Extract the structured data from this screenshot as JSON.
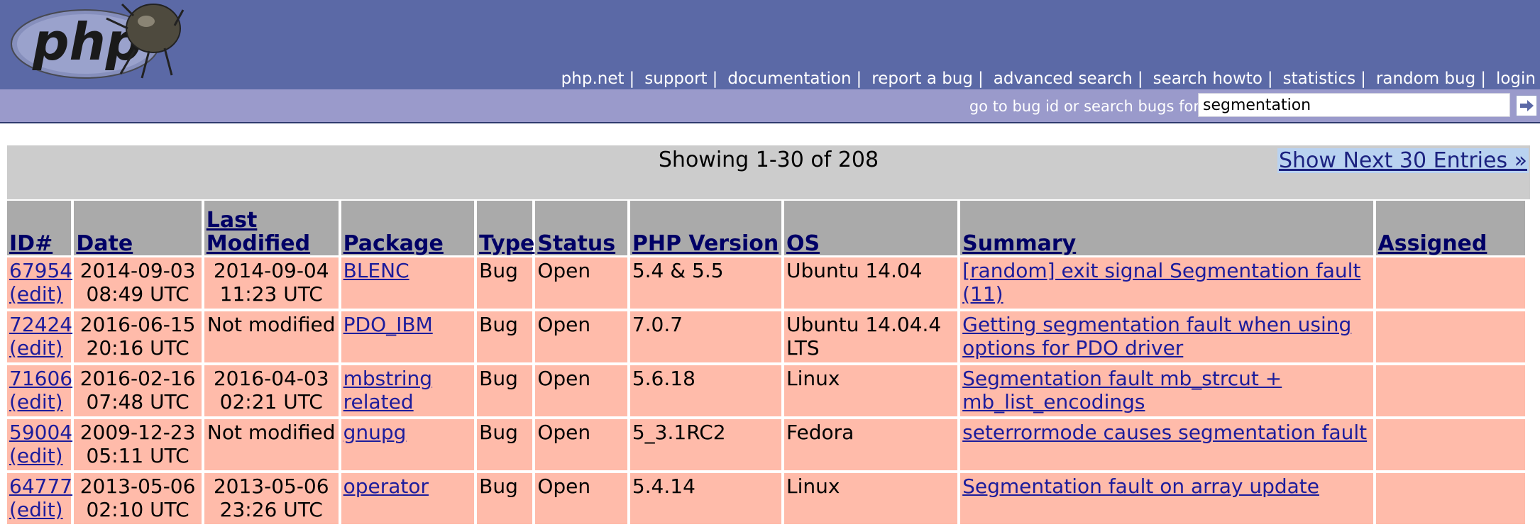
{
  "header": {
    "logo_text": "php",
    "nav": [
      "php.net",
      "support",
      "documentation",
      "report a bug",
      "advanced search",
      "search howto",
      "statistics",
      "random bug",
      "login"
    ]
  },
  "search": {
    "label": "go to bug id or search bugs for",
    "value": "segmentation"
  },
  "results": {
    "showing": "Showing 1-30 of 208",
    "next_link": "Show Next 30 Entries »"
  },
  "table": {
    "columns": [
      "ID#",
      "Date",
      "Last Modified",
      "Package",
      "Type",
      "Status",
      "PHP Version",
      "OS",
      "Summary",
      "Assigned"
    ],
    "rows": [
      {
        "id": "67954",
        "edit": "(edit)",
        "date": "2014-09-03",
        "date_time": "08:49 UTC",
        "modified": "2014-09-04",
        "modified_time": "11:23 UTC",
        "package": "BLENC",
        "type": "Bug",
        "status": "Open",
        "php_version": "5.4 & 5.5",
        "os": "Ubuntu 14.04",
        "summary": "[random] exit signal Segmentation fault (11)",
        "assigned": ""
      },
      {
        "id": "72424",
        "edit": "(edit)",
        "date": "2016-06-15",
        "date_time": "20:16 UTC",
        "modified": "Not modified",
        "modified_time": "",
        "package": "PDO_IBM",
        "type": "Bug",
        "status": "Open",
        "php_version": "7.0.7",
        "os": "Ubuntu 14.04.4 LTS",
        "summary": "Getting segmentation fault when using options for PDO driver",
        "assigned": ""
      },
      {
        "id": "71606",
        "edit": "(edit)",
        "date": "2016-02-16",
        "date_time": "07:48 UTC",
        "modified": "2016-04-03",
        "modified_time": "02:21 UTC",
        "package": "mbstring related",
        "type": "Bug",
        "status": "Open",
        "php_version": "5.6.18",
        "os": "Linux",
        "summary": "Segmentation fault mb_strcut + mb_list_encodings",
        "assigned": ""
      },
      {
        "id": "59004",
        "edit": "(edit)",
        "date": "2009-12-23",
        "date_time": "05:11 UTC",
        "modified": "Not modified",
        "modified_time": "",
        "package": "gnupg",
        "type": "Bug",
        "status": "Open",
        "php_version": "5_3.1RC2",
        "os": "Fedora",
        "summary": "seterrormode causes segmentation fault",
        "assigned": ""
      },
      {
        "id": "64777",
        "edit": "(edit)",
        "date": "2013-05-06",
        "date_time": "02:10 UTC",
        "modified": "2013-05-06",
        "modified_time": "23:26 UTC",
        "package": "operator",
        "type": "Bug",
        "status": "Open",
        "php_version": "5.4.14",
        "os": "Linux",
        "summary": "Segmentation fault on array update",
        "assigned": ""
      }
    ]
  }
}
